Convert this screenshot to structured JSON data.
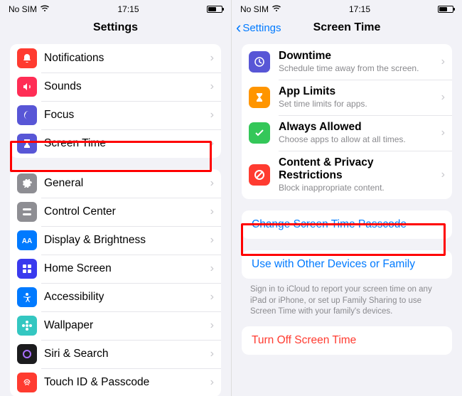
{
  "status": {
    "carrier": "No SIM",
    "wifi": "wifi",
    "time": "17:15"
  },
  "left": {
    "title": "Settings",
    "group1": [
      {
        "label": "Notifications",
        "icon": "bell",
        "color": "#ff3b30"
      },
      {
        "label": "Sounds",
        "icon": "speaker",
        "color": "#ff2d55"
      },
      {
        "label": "Focus",
        "icon": "moon",
        "color": "#5856d6"
      },
      {
        "label": "Screen Time",
        "icon": "hourglass",
        "color": "#5856d6"
      }
    ],
    "group2": [
      {
        "label": "General",
        "icon": "gear",
        "color": "#8e8e93"
      },
      {
        "label": "Control Center",
        "icon": "switches",
        "color": "#8e8e93"
      },
      {
        "label": "Display & Brightness",
        "icon": "aa",
        "color": "#007aff"
      },
      {
        "label": "Home Screen",
        "icon": "grid",
        "color": "#4a4aff"
      },
      {
        "label": "Accessibility",
        "icon": "person",
        "color": "#007aff"
      },
      {
        "label": "Wallpaper",
        "icon": "flower",
        "color": "#34c7c1"
      },
      {
        "label": "Siri & Search",
        "icon": "siri",
        "color": "#1c1c1e"
      },
      {
        "label": "Touch ID & Passcode",
        "icon": "fingerprint",
        "color": "#ff3b30"
      }
    ]
  },
  "right": {
    "back": "Settings",
    "title": "Screen Time",
    "features": [
      {
        "title": "Downtime",
        "sub": "Schedule time away from the screen.",
        "icon": "clock",
        "color": "#5856d6"
      },
      {
        "title": "App Limits",
        "sub": "Set time limits for apps.",
        "icon": "hourglass",
        "color": "#ff9500"
      },
      {
        "title": "Always Allowed",
        "sub": "Choose apps to allow at all times.",
        "icon": "check",
        "color": "#34c759"
      },
      {
        "title": "Content & Privacy Restrictions",
        "sub": "Block inappropriate content.",
        "icon": "nosign",
        "color": "#ff3b30"
      }
    ],
    "change_passcode": "Change Screen Time Passcode",
    "use_family": "Use with Other Devices or Family",
    "family_note": "Sign in to iCloud to report your screen time on any iPad or iPhone, or set up Family Sharing to use Screen Time with your family's devices.",
    "turn_off": "Turn Off Screen Time"
  }
}
